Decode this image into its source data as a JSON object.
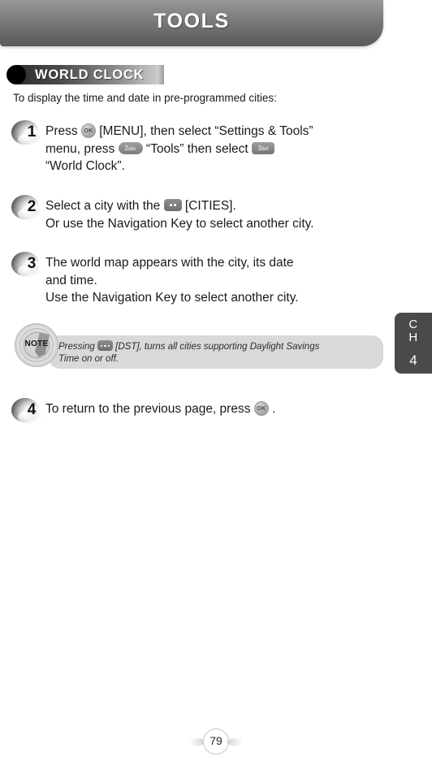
{
  "header": {
    "title": "TOOLS"
  },
  "section": {
    "badge_label": "WORLD CLOCK",
    "intro": "To display the time and date in pre-programmed cities:"
  },
  "steps": [
    {
      "number": "1",
      "line1_a": "Press",
      "key1": {
        "type": "ok-key",
        "label": "OK"
      },
      "line1_b": "[MENU], then select “Settings & Tools”",
      "line2_a": "menu, press",
      "key2": {
        "type": "number-key-pill",
        "digit": "2",
        "letters": "abc"
      },
      "line2_b": "“Tools” then select",
      "key3": {
        "type": "number-key-rect",
        "digit": "3",
        "letters": "def"
      },
      "line3": "“World Clock”."
    },
    {
      "number": "2",
      "line1_a": "Select a city with the",
      "key1": {
        "type": "soft-key-two-dots"
      },
      "line1_b": "[CITIES].",
      "line2": "Or use the Navigation Key to select another city."
    },
    {
      "number": "3",
      "line1": "The world map appears with the city, its date",
      "line2": "and time.",
      "line3": "Use the Navigation Key to select another city."
    },
    {
      "number": "4",
      "line1_a": "To return to the previous page, press",
      "key1": {
        "type": "ok-key",
        "label": "OK"
      },
      "line1_b": "."
    }
  ],
  "note": {
    "icon_label": "NOTE",
    "line1_a": "Pressing",
    "key1": {
      "type": "soft-key-three-dots"
    },
    "line1_b": "[DST], turns all cities supporting Daylight Savings",
    "line2": "Time on or off."
  },
  "chapter_tab": {
    "line1": "C",
    "line2": "H",
    "number": "4"
  },
  "footer": {
    "page_number": "79"
  },
  "colors": {
    "header_gradient_top": "#9a9a9a",
    "header_gradient_bottom": "#5a5a5a",
    "badge_dot": "#000000",
    "note_box_bg": "#d9d9d9",
    "chapter_tab_bg": "#4a4a4a",
    "text": "#1a1a1a"
  }
}
